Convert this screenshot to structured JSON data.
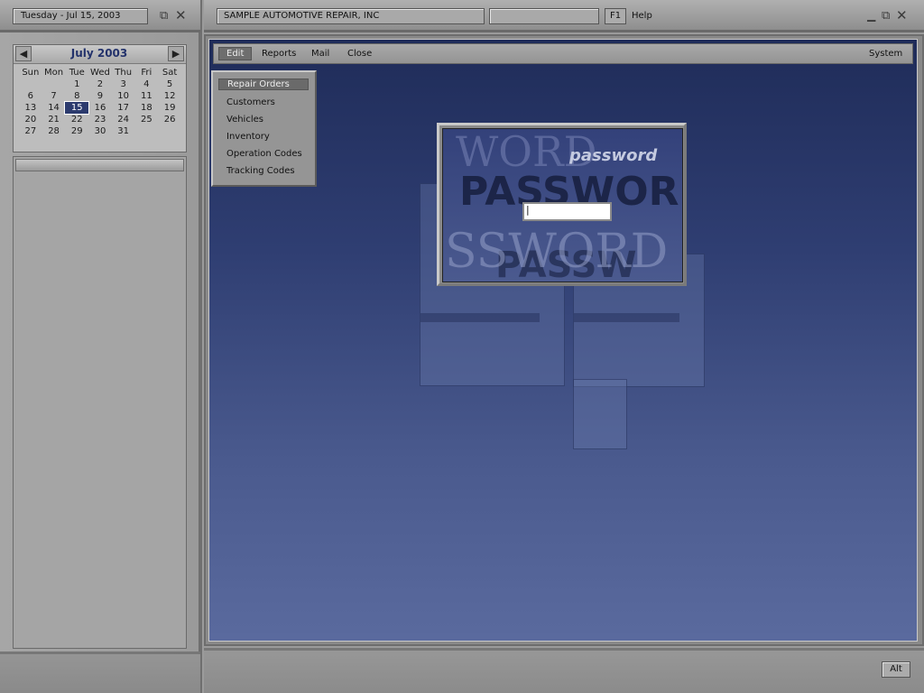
{
  "left": {
    "date_label": "Tuesday - Jul 15, 2003",
    "icons": [
      "restore-icon",
      "close-icon"
    ]
  },
  "calendar": {
    "month_title": "July  2003",
    "prev_icon": "◀",
    "next_icon": "▶",
    "weekdays": [
      "Sun",
      "Mon",
      "Tue",
      "Wed",
      "Thu",
      "Fri",
      "Sat"
    ],
    "weeks": [
      [
        "",
        "",
        "1",
        "2",
        "3",
        "4",
        "5"
      ],
      [
        "6",
        "7",
        "8",
        "9",
        "10",
        "11",
        "12"
      ],
      [
        "13",
        "14",
        "15",
        "16",
        "17",
        "18",
        "19"
      ],
      [
        "20",
        "21",
        "22",
        "23",
        "24",
        "25",
        "26"
      ],
      [
        "27",
        "28",
        "29",
        "30",
        "31",
        "",
        ""
      ]
    ],
    "selected_day": "15"
  },
  "header": {
    "company": "SAMPLE AUTOMOTIVE REPAIR, INC",
    "f1_label": "F1",
    "help_label": "Help",
    "window_icons": [
      "minimize-icon",
      "restore-icon",
      "close-icon"
    ]
  },
  "menu": {
    "edit": "Edit",
    "reports": "Reports",
    "mail": "Mail",
    "close": "Close",
    "system": "System"
  },
  "dropdown": {
    "items": [
      "Repair Orders",
      "Customers",
      "Vehicles",
      "Inventory",
      "Operation Codes",
      "Tracking Codes"
    ]
  },
  "password_dialog": {
    "title": "password",
    "watermark_1": "WORD",
    "watermark_2": "PASSWORD",
    "watermark_3": "SSWORD",
    "watermark_4": "PASSW",
    "value": "|"
  },
  "footer": {
    "alt_label": "Alt"
  },
  "colors": {
    "desktop_top": "#1f2c59",
    "desktop_bottom": "#5a6a9e",
    "selected_day_bg": "#2c3b6e",
    "month_title": "#23326b"
  }
}
